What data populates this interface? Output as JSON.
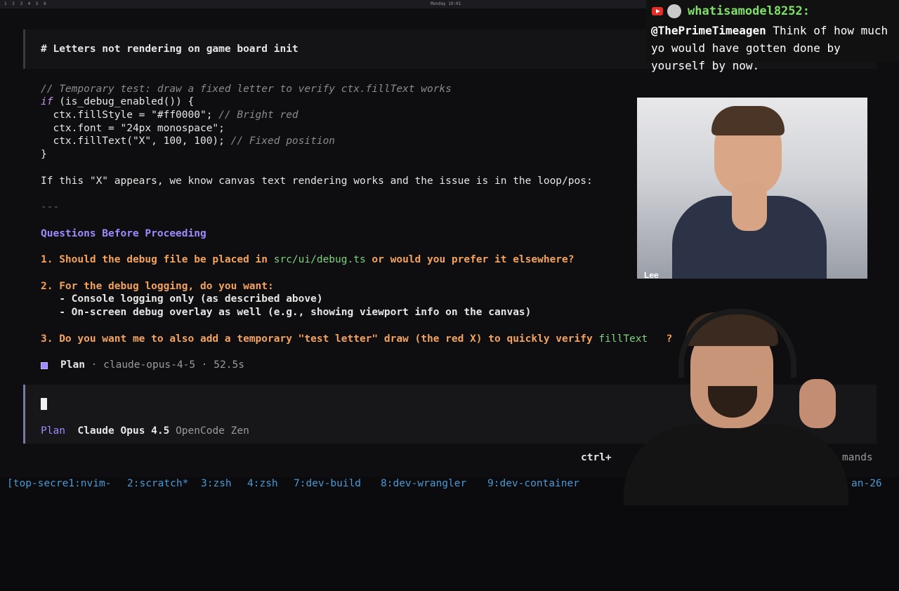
{
  "topbar": {
    "workspaces": "1 2 3 4 5 6",
    "clock": "Monday 10:01"
  },
  "heading": "# Letters not rendering on game board init",
  "code": {
    "comment_line": "// Temporary test: draw a fixed letter to verify ctx.fillText works",
    "if_kw": "if",
    "if_rest": " (is_debug_enabled()) {",
    "line_fillstyle": "  ctx.fillStyle = \"#ff0000\";",
    "line_fillstyle_comment": " // Bright red",
    "line_font": "  ctx.font = \"24px monospace\";",
    "line_filltext": "  ctx.fillText(\"X\", 100, 100);",
    "line_filltext_comment": " // Fixed position",
    "close": "}"
  },
  "explanation": "If this \"X\" appears, we know canvas text rendering works and the issue is in the loop/pos:",
  "rule": "---",
  "questions_heading": "Questions Before Proceeding",
  "questions": {
    "q1_pre": "1. Should the debug file be placed in ",
    "q1_path": "src/ui/debug.ts",
    "q1_post": " or would you prefer it elsewhere?",
    "q2": "2. For the debug logging, do you want:",
    "q2_opt1": "   - Console logging only (as described above)",
    "q2_opt2": "   - On-screen debug overlay as well (e.g., showing viewport info on the canvas)",
    "q3_pre": "3. Do you want me to also add a temporary \"test letter\" draw (the red X) to quickly verify ",
    "q3_code": "fillText",
    "q3_post": "   ?"
  },
  "status_line": {
    "mode": "Plan",
    "model": "claude-opus-4-5",
    "sep": " · ",
    "time": "52.5s"
  },
  "input_footer": {
    "mode": "Plan",
    "model": "Claude Opus 4.5",
    "provider": "OpenCode Zen"
  },
  "hint": {
    "left": "ctrl+",
    "right": "mands"
  },
  "tmux": {
    "w1": "[top-secre1:nvim-",
    "w2": "2:scratch*",
    "w3": "3:zsh",
    "w4": "4:zsh",
    "w7": "7:dev-build",
    "w8": "8:dev-wrangler",
    "w9": "9:dev-container",
    "right": "an-26"
  },
  "chat": {
    "username": "whatisamodel8252:",
    "mention": "@ThePrimeTimeagen",
    "message": " Think of how much yo would have gotten done by yourself by now."
  },
  "webcam": {
    "label": "Lee"
  }
}
